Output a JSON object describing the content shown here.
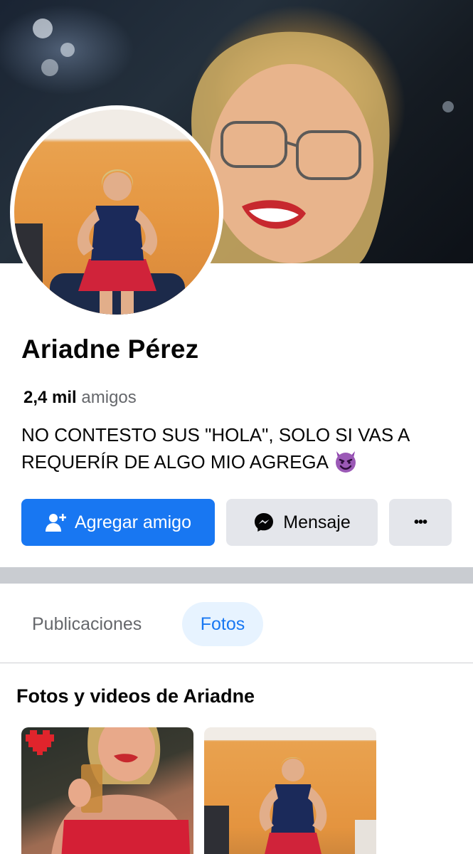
{
  "profile": {
    "name": "Ariadne Pérez",
    "friends_count": "2,4 mil",
    "friends_label": "amigos",
    "bio": "NO CONTESTO SUS \"HOLA\", SOLO SI VAS A REQUERÍR DE ALGO MIO AGREGA",
    "bio_emoji": "smiling-devil-emoji"
  },
  "actions": {
    "add_friend_label": "Agregar amigo",
    "add_friend_icon": "add-friend-icon",
    "message_label": "Mensaje",
    "message_icon": "messenger-icon",
    "more_label": "•••"
  },
  "tabs": [
    {
      "label": "Publicaciones",
      "active": false
    },
    {
      "label": "Fotos",
      "active": true
    }
  ],
  "photos_section": {
    "title": "Fotos y videos de Ariadne"
  },
  "colors": {
    "accent": "#1877f2",
    "accent_light": "#e7f3ff",
    "secondary_button": "#e4e6eb",
    "muted_text": "#65676b"
  }
}
